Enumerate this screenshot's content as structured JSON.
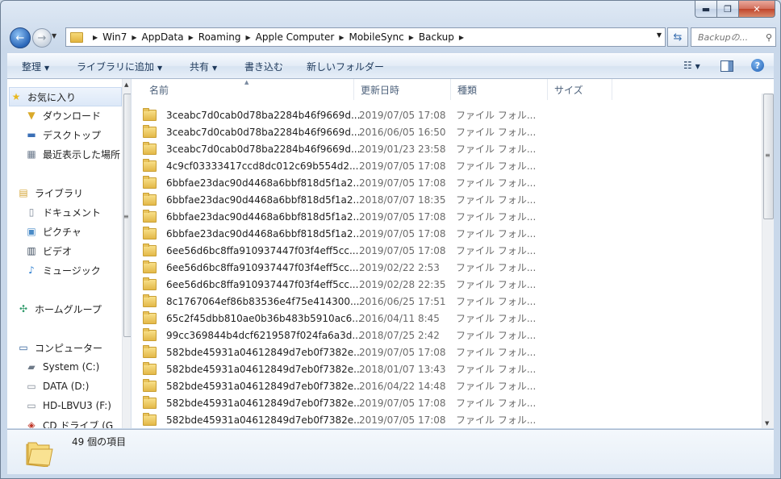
{
  "window": {
    "caption_min": "▬",
    "caption_max": "❐",
    "caption_close": "✕"
  },
  "nav_buttons": {
    "back_glyph": "←",
    "forward_glyph": "→"
  },
  "address": {
    "breadcrumbs": [
      "Win7",
      "AppData",
      "Roaming",
      "Apple Computer",
      "MobileSync",
      "Backup"
    ]
  },
  "search": {
    "placeholder": "Backupの..."
  },
  "toolbar": {
    "organize": "整理",
    "add_to_library": "ライブラリに追加",
    "share": "共有",
    "burn": "書き込む",
    "new_folder": "新しいフォルダー"
  },
  "navpane": {
    "items": [
      {
        "label": "お気に入り",
        "icon": "star-icon"
      },
      {
        "label": "ダウンロード",
        "icon": "download-folder-icon"
      },
      {
        "label": "デスクトップ",
        "icon": "desktop-icon"
      },
      {
        "label": "最近表示した場所",
        "icon": "recent-places-icon"
      },
      {
        "label": "ライブラリ",
        "icon": "library-icon"
      },
      {
        "label": "ドキュメント",
        "icon": "document-icon"
      },
      {
        "label": "ピクチャ",
        "icon": "picture-icon"
      },
      {
        "label": "ビデオ",
        "icon": "video-icon"
      },
      {
        "label": "ミュージック",
        "icon": "music-icon"
      },
      {
        "label": "ホームグループ",
        "icon": "homegroup-icon"
      },
      {
        "label": "コンピューター",
        "icon": "computer-icon"
      },
      {
        "label": "System (C:)",
        "icon": "system-drive-icon"
      },
      {
        "label": "DATA (D:)",
        "icon": "drive-icon"
      },
      {
        "label": "HD-LBVU3 (F:)",
        "icon": "external-drive-icon"
      },
      {
        "label": "CD ドライブ (G",
        "icon": "cd-drive-icon"
      }
    ]
  },
  "columns": {
    "name": "名前",
    "date": "更新日時",
    "type": "種類",
    "size": "サイズ"
  },
  "files": [
    {
      "name": "3ceabc7d0cab0d78ba2284b46f9669d...",
      "date": "2019/07/05 17:08",
      "type": "ファイル フォル..."
    },
    {
      "name": "3ceabc7d0cab0d78ba2284b46f9669d...",
      "date": "2016/06/05 16:50",
      "type": "ファイル フォル..."
    },
    {
      "name": "3ceabc7d0cab0d78ba2284b46f9669d...",
      "date": "2019/01/23 23:58",
      "type": "ファイル フォル..."
    },
    {
      "name": "4c9cf03333417ccd8dc012c69b554d2...",
      "date": "2019/07/05 17:08",
      "type": "ファイル フォル..."
    },
    {
      "name": "6bbfae23dac90d4468a6bbf818d5f1a2...",
      "date": "2019/07/05 17:08",
      "type": "ファイル フォル..."
    },
    {
      "name": "6bbfae23dac90d4468a6bbf818d5f1a2...",
      "date": "2018/07/07 18:35",
      "type": "ファイル フォル..."
    },
    {
      "name": "6bbfae23dac90d4468a6bbf818d5f1a2...",
      "date": "2019/07/05 17:08",
      "type": "ファイル フォル..."
    },
    {
      "name": "6bbfae23dac90d4468a6bbf818d5f1a2...",
      "date": "2019/07/05 17:08",
      "type": "ファイル フォル..."
    },
    {
      "name": "6ee56d6bc8ffa910937447f03f4eff5cc...",
      "date": "2019/07/05 17:08",
      "type": "ファイル フォル..."
    },
    {
      "name": "6ee56d6bc8ffa910937447f03f4eff5cc...",
      "date": "2019/02/22 2:53",
      "type": "ファイル フォル..."
    },
    {
      "name": "6ee56d6bc8ffa910937447f03f4eff5cc...",
      "date": "2019/02/28 22:35",
      "type": "ファイル フォル..."
    },
    {
      "name": "8c1767064ef86b83536e4f75e414300...",
      "date": "2016/06/25 17:51",
      "type": "ファイル フォル..."
    },
    {
      "name": "65c2f45dbb810ae0b36b483b5910ac6...",
      "date": "2016/04/11 8:45",
      "type": "ファイル フォル..."
    },
    {
      "name": "99cc369844b4dcf6219587f024fa6a3d...",
      "date": "2018/07/25 2:42",
      "type": "ファイル フォル..."
    },
    {
      "name": "582bde45931a04612849d7eb0f7382e...",
      "date": "2019/07/05 17:08",
      "type": "ファイル フォル..."
    },
    {
      "name": "582bde45931a04612849d7eb0f7382e...",
      "date": "2018/01/07 13:43",
      "type": "ファイル フォル..."
    },
    {
      "name": "582bde45931a04612849d7eb0f7382e...",
      "date": "2016/04/22 14:48",
      "type": "ファイル フォル..."
    },
    {
      "name": "582bde45931a04612849d7eb0f7382e...",
      "date": "2019/07/05 17:08",
      "type": "ファイル フォル..."
    },
    {
      "name": "582bde45931a04612849d7eb0f7382e...",
      "date": "2019/07/05 17:08",
      "type": "ファイル フォル..."
    }
  ],
  "details": {
    "item_count": "49 個の項目"
  }
}
